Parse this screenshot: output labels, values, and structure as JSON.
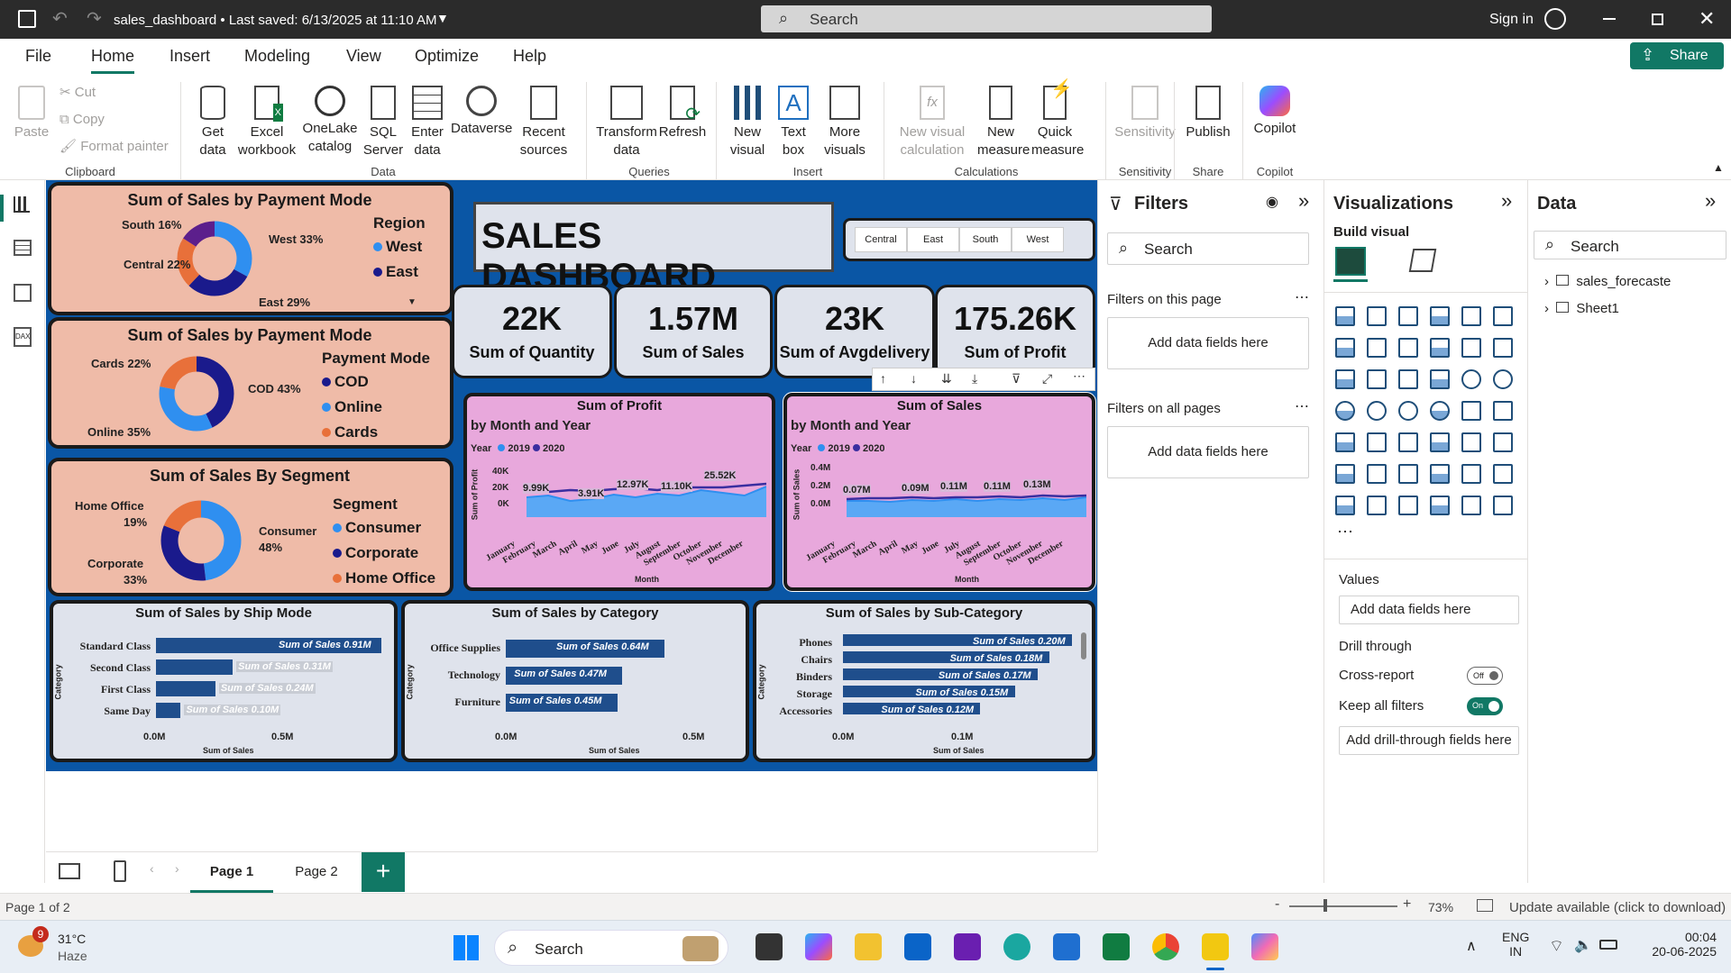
{
  "titlebar": {
    "file_title": "sales_dashboard • Last saved: 6/13/2025 at 11:10 AM",
    "search_placeholder": "Search",
    "signin": "Sign in"
  },
  "menu": {
    "tabs": [
      "File",
      "Home",
      "Insert",
      "Modeling",
      "View",
      "Optimize",
      "Help"
    ],
    "share": "Share"
  },
  "ribbon": {
    "clipboard": {
      "paste": "Paste",
      "cut": "Cut",
      "copy": "Copy",
      "format_painter": "Format painter",
      "group": "Clipboard"
    },
    "data": {
      "get_data": "Get data",
      "excel": "Excel workbook",
      "onelake": "OneLake catalog",
      "sql": "SQL Server",
      "enter": "Enter data",
      "dataverse": "Dataverse",
      "recent": "Recent sources",
      "group": "Data"
    },
    "queries": {
      "transform": "Transform data",
      "refresh": "Refresh",
      "group": "Queries"
    },
    "insert": {
      "new_visual": "New visual",
      "text_box": "Text box",
      "more_visuals": "More visuals",
      "group": "Insert"
    },
    "calculations": {
      "new_visual_calc": "New visual calculation",
      "new_measure": "New measure",
      "quick_measure": "Quick measure",
      "group": "Calculations"
    },
    "sensitivity": {
      "label": "Sensitivity",
      "group": "Sensitivity"
    },
    "share": {
      "publish": "Publish",
      "group": "Share"
    },
    "copilot": {
      "label": "Copilot",
      "group": "Copilot"
    }
  },
  "dashboard": {
    "title": "SALES DASHBOARD",
    "region_slicer": [
      "Central",
      "East",
      "South",
      "West"
    ],
    "kpis": [
      {
        "value": "22K",
        "label": "Sum of Quantity"
      },
      {
        "value": "1.57M",
        "label": "Sum of Sales"
      },
      {
        "value": "23K",
        "label": "Sum of Avgdelivery"
      },
      {
        "value": "175.26K",
        "label": "Sum of Profit"
      }
    ],
    "donut_region": {
      "title": "Sum of Sales by Payment Mode",
      "legend_title": "Region",
      "legend": [
        "West",
        "East"
      ],
      "labels": [
        "South 16%",
        "West 33%",
        "Central 22%",
        "East 29%"
      ]
    },
    "donut_payment": {
      "title": "Sum of Sales by Payment Mode",
      "legend_title": "Payment Mode",
      "legend": [
        "COD",
        "Online",
        "Cards"
      ],
      "labels": [
        "Cards 22%",
        "COD 43%",
        "Online 35%"
      ]
    },
    "donut_segment": {
      "title": "Sum of Sales By Segment",
      "legend_title": "Segment",
      "legend": [
        "Consumer",
        "Corporate",
        "Home Office"
      ],
      "labels": [
        "Home Office",
        "19%",
        "Consumer",
        "48%",
        "Corporate",
        "33%"
      ]
    },
    "line_profit": {
      "title": "Sum of Profit",
      "subtitle": "by Month and Year",
      "legend_label": "Year",
      "series": [
        "2019",
        "2020"
      ],
      "yticks": [
        "40K",
        "20K",
        "0K"
      ],
      "ylabel": "Sum of Profit",
      "xlabel": "Month",
      "labels": [
        "9.99K",
        "3.91K",
        "12.97K",
        "11.10K",
        "25.52K"
      ]
    },
    "line_sales": {
      "title": "Sum of Sales",
      "subtitle": "by Month and Year",
      "legend_label": "Year",
      "series": [
        "2019",
        "2020"
      ],
      "yticks": [
        "0.4M",
        "0.2M",
        "0.0M"
      ],
      "ylabel": "Sum of Sales",
      "xlabel": "Month",
      "labels": [
        "0.07M",
        "0.09M",
        "0.11M",
        "0.11M",
        "0.13M"
      ]
    },
    "months": [
      "January",
      "February",
      "March",
      "April",
      "May",
      "June",
      "July",
      "August",
      "September",
      "October",
      "November",
      "December"
    ],
    "bar_ship": {
      "title": "Sum of Sales by Ship Mode",
      "ylabel": "Category",
      "xlabel": "Sum of Sales",
      "xticks": [
        "0.0M",
        "0.5M"
      ],
      "rows": [
        {
          "name": "Standard Class",
          "label": "Sum of Sales 0.91M",
          "value": 0.91
        },
        {
          "name": "Second Class",
          "label": "Sum of Sales 0.31M",
          "value": 0.31
        },
        {
          "name": "First Class",
          "label": "Sum of Sales 0.24M",
          "value": 0.24
        },
        {
          "name": "Same Day",
          "label": "Sum of Sales 0.10M",
          "value": 0.1
        }
      ]
    },
    "bar_category": {
      "title": "Sum of Sales by Category",
      "ylabel": "Category",
      "xlabel": "Sum of Sales",
      "xticks": [
        "0.0M",
        "0.5M"
      ],
      "rows": [
        {
          "name": "Office Supplies",
          "label": "Sum of Sales 0.64M",
          "value": 0.64
        },
        {
          "name": "Technology",
          "label": "Sum of Sales 0.47M",
          "value": 0.47
        },
        {
          "name": "Furniture",
          "label": "Sum of Sales 0.45M",
          "value": 0.45
        }
      ]
    },
    "bar_subcat": {
      "title": "Sum of Sales by Sub-Category",
      "ylabel": "Category",
      "xlabel": "Sum of Sales",
      "xticks": [
        "0.0M",
        "0.1M"
      ],
      "rows": [
        {
          "name": "Phones",
          "label": "Sum of Sales 0.20M",
          "value": 0.2
        },
        {
          "name": "Chairs",
          "label": "Sum of Sales 0.18M",
          "value": 0.18
        },
        {
          "name": "Binders",
          "label": "Sum of Sales 0.17M",
          "value": 0.17
        },
        {
          "name": "Storage",
          "label": "Sum of Sales 0.15M",
          "value": 0.15
        },
        {
          "name": "Accessories",
          "label": "Sum of Sales 0.12M",
          "value": 0.12
        }
      ]
    }
  },
  "filters": {
    "title": "Filters",
    "search": "Search",
    "on_page": "Filters on this page",
    "on_all": "Filters on all pages",
    "add_fields": "Add data fields here"
  },
  "viz": {
    "title": "Visualizations",
    "build": "Build visual",
    "values": "Values",
    "add_fields": "Add data fields here",
    "drill": "Drill through",
    "cross": "Cross-report",
    "cross_state": "Off",
    "keep": "Keep all filters",
    "keep_state": "On",
    "add_drill": "Add drill-through fields here"
  },
  "data_pane": {
    "title": "Data",
    "search": "Search",
    "tables": [
      "sales_forecaste",
      "Sheet1"
    ]
  },
  "pages": {
    "tabs": [
      "Page 1",
      "Page 2"
    ],
    "add": "+"
  },
  "status": {
    "page": "Page 1 of 2",
    "zoom": "73%",
    "update": "Update available (click to download)"
  },
  "taskbar": {
    "weather_temp": "31°C",
    "weather_desc": "Haze",
    "badge": "9",
    "search": "Search",
    "lang1": "ENG",
    "lang2": "IN",
    "time": "00:04",
    "date": "20-06-2025"
  },
  "colors": {
    "canvas": "#0a56a5",
    "card": "#efbba8",
    "pink": "#e8a8dc",
    "dark": "#1a1a8c",
    "blue": "#2f8ff0",
    "orange": "#e8703a",
    "purple": "#5c1f8c"
  }
}
